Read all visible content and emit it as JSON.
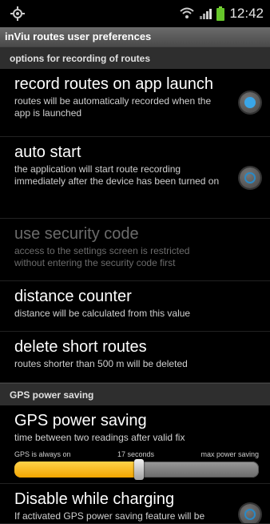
{
  "status_bar": {
    "time": "12:42",
    "icons": [
      "gps-icon",
      "wifi-icon",
      "signal-icon",
      "battery-icon"
    ]
  },
  "window": {
    "title": "inViu routes user preferences"
  },
  "sections": [
    {
      "header": "options for recording of routes",
      "prefs": [
        {
          "title": "record routes on app launch",
          "summary": "routes will be automatically recorded when the app is launched",
          "control": "radio",
          "checked": true
        },
        {
          "title": "auto start",
          "summary": "the application will start route recording immediately after the device has been turned on",
          "control": "radio",
          "checked": false
        },
        {
          "title": "use security code",
          "summary": "access to the settings screen is restricted without entering the security code first",
          "control": "none",
          "disabled": true
        },
        {
          "title": "distance counter",
          "summary": "distance will be calculated from this value",
          "control": "none"
        },
        {
          "title": "delete short routes",
          "summary": "routes shorter than 500 m will be deleted",
          "control": "none"
        }
      ]
    },
    {
      "header": "GPS power saving",
      "prefs": [
        {
          "title": "GPS power saving",
          "summary": "time between two readings after valid fix",
          "control": "seekbar",
          "seekbar": {
            "min_label": "GPS is always on",
            "value_label": "17 seconds",
            "max_label": "max power saving",
            "fraction": 0.51
          }
        },
        {
          "title": "Disable while charging",
          "summary": "If activated GPS power saving feature will be",
          "control": "radio",
          "checked": false
        }
      ]
    }
  ],
  "colors": {
    "accent": "#3aa6e8",
    "seek_fill": "#f2a500"
  }
}
